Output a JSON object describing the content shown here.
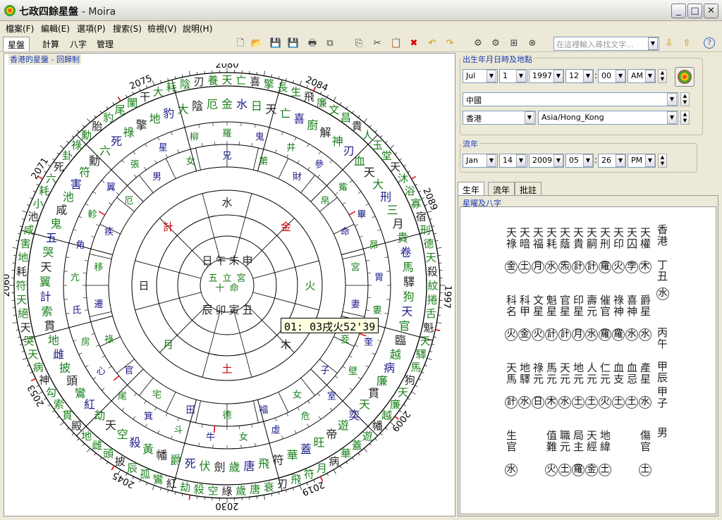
{
  "window": {
    "title": "七政四餘星盤",
    "app": "- Moira",
    "minimize": "_",
    "maximize": "□",
    "close": "✕"
  },
  "menu": [
    "檔案(F)",
    "編輯(E)",
    "選項(P)",
    "搜索(S)",
    "檢視(V)",
    "說明(H)"
  ],
  "toolbar": {
    "tabs": [
      "星盤",
      "計算",
      "八字",
      "管理"
    ],
    "search_placeholder": "在這裡輸入尋找文字...",
    "icons": [
      "new-icon",
      "open-icon",
      "save-icon",
      "save-as-icon",
      "print-icon",
      "export-icon",
      "copy-icon",
      "cut-icon",
      "paste-icon",
      "delete-icon",
      "undo-icon",
      "redo-icon",
      "tool1-icon",
      "tool2-icon",
      "tool3-icon",
      "tool4-icon"
    ]
  },
  "chart": {
    "caption": "香港的星盤 - 回歸制",
    "tooltip": "01: 03戌火52'39",
    "years": [
      {
        "t": "2080",
        "a": -90
      },
      {
        "t": "2084",
        "a": -66
      },
      {
        "t": "2089",
        "a": -23
      },
      {
        "t": "1997",
        "a": 3
      },
      {
        "t": "2009",
        "a": 38
      },
      {
        "t": "2019",
        "a": 67
      },
      {
        "t": "2030",
        "a": 90
      },
      {
        "t": "2045",
        "a": 118
      },
      {
        "t": "2053",
        "a": 150
      },
      {
        "t": "2060",
        "a": 180
      },
      {
        "t": "2071",
        "a": -148
      },
      {
        "t": "2075",
        "a": -113
      }
    ],
    "center": [
      "五",
      "十",
      "立",
      "命",
      "宮"
    ],
    "pillars": [
      [
        "日",
        "午",
        "未",
        "申"
      ],
      [
        "辰",
        "卯",
        "寅",
        "丑"
      ]
    ],
    "ring1": [
      "水",
      "金",
      "火",
      "木",
      "土",
      "月",
      "日",
      "計"
    ],
    "ring2": [
      "兄",
      "第",
      "財",
      "帛",
      "命",
      "宮",
      "妻",
      "妾",
      "子",
      "女",
      "福",
      "德",
      "田",
      "宅",
      "官",
      "祿",
      "遷",
      "移",
      "疾",
      "厄",
      "男",
      "女"
    ],
    "ring3": [
      "羅",
      "鬼",
      "井",
      "參",
      "觜",
      "畢",
      "昴",
      "胃",
      "婁",
      "奎",
      "壁",
      "室",
      "危",
      "虛",
      "女",
      "牛",
      "斗",
      "箕",
      "尾",
      "心",
      "房",
      "氐",
      "亢",
      "角",
      "軫",
      "翼",
      "張",
      "星",
      "柳"
    ],
    "ring4": [
      "金",
      "水",
      "日",
      "天",
      "亡",
      "喜",
      "廚",
      "解",
      "神",
      "刃",
      "血",
      "天",
      "大",
      "刑",
      "三",
      "月",
      "貴",
      "卷",
      "馬",
      "驛",
      "狗",
      "天",
      "官",
      "臨",
      "越",
      "病",
      "廉",
      "貫",
      "天",
      "奕",
      "遊",
      "帝",
      "旺",
      "蓋",
      "華",
      "符",
      "飛",
      "唐",
      "歲",
      "劍",
      "伏",
      "死",
      "爵",
      "幡",
      "黃",
      "殺",
      "空",
      "天",
      "劫",
      "紅",
      "鸞",
      "頭",
      "披",
      "雌",
      "地",
      "貫",
      "索",
      "計",
      "翼",
      "天",
      "哭",
      "五",
      "鬼",
      "咸",
      "池",
      "害",
      "符",
      "勳",
      "六",
      "死",
      "祿",
      "擎",
      "地",
      "豹",
      "大",
      "陰",
      "厄"
    ],
    "outer": [
      "天",
      "亡",
      "喜",
      "擎",
      "長",
      "生",
      "飛",
      "廉",
      "文",
      "昌",
      "貴",
      "人",
      "玉",
      "堂",
      "天",
      "沐",
      "浴",
      "寡",
      "宿",
      "刑",
      "德",
      "天",
      "殺",
      "紋",
      "捲",
      "舌",
      "魁",
      "天",
      "驛",
      "馬",
      "狗",
      "天",
      "廉",
      "越",
      "幡",
      "遊",
      "蓋",
      "華",
      "病",
      "月",
      "符",
      "飛",
      "刃",
      "衰",
      "唐",
      "歲",
      "綠",
      "空",
      "殺",
      "劫",
      "紅",
      "鸞",
      "孤",
      "辰",
      "披",
      "頭",
      "雌",
      "地",
      "殿",
      "貫",
      "索",
      "勾",
      "神",
      "病",
      "天",
      "哭",
      "天",
      "絕",
      "天",
      "符",
      "耗",
      "地",
      "害",
      "咸",
      "池",
      "小",
      "耗",
      "六",
      "死",
      "卦",
      "祿",
      "勳",
      "胎",
      "豹",
      "尾",
      "闌",
      "干",
      "大",
      "耗",
      "陰",
      "刃",
      "養"
    ]
  },
  "birth": {
    "group": "出生年月日時及地點",
    "month": "Jul",
    "day": "1",
    "year": "1997",
    "hour": "12",
    "minute": "00",
    "ampm": "AM",
    "country": "中國",
    "city": "香港",
    "timezone": "Asia/Hong_Kong"
  },
  "transit": {
    "group": "流年",
    "month": "Jan",
    "day": "14",
    "year": "2009",
    "hour": "05",
    "minute": "26",
    "ampm": "PM"
  },
  "tabs": {
    "natal": "生年",
    "annual": "流年",
    "notes": "批註"
  },
  "stars": {
    "caption": "星曜及八字",
    "place": "香港",
    "year_pillar": "丁丑",
    "nayin": "水",
    "gender": "男",
    "bazi": [
      "丙午",
      "甲辰",
      "甲子"
    ],
    "row1": [
      [
        "天權",
        "木"
      ],
      [
        "天囚",
        "孛"
      ],
      [
        "天印",
        "火"
      ],
      [
        "天刑",
        "羅"
      ],
      [
        "天嗣",
        "計"
      ],
      [
        "天貴",
        "計"
      ],
      [
        "天蔭",
        "炁"
      ],
      [
        "天耗",
        "水"
      ],
      [
        "天福",
        "月"
      ],
      [
        "天暗",
        "土"
      ],
      [
        "天祿",
        "金"
      ]
    ],
    "row2": [
      [
        "爵星",
        "水"
      ],
      [
        "喜神",
        "水"
      ],
      [
        "祿神",
        "羅"
      ],
      [
        "催官",
        "羅"
      ],
      [
        "壽元",
        "水"
      ],
      [
        "印星",
        "月"
      ],
      [
        "官星",
        "計"
      ],
      [
        "魁星",
        "計"
      ],
      [
        "文星",
        "火"
      ],
      [
        "科甲",
        "金"
      ],
      [
        "科名",
        "火"
      ]
    ],
    "row3": [
      [
        "產星",
        "水"
      ],
      [
        "血忌",
        "土"
      ],
      [
        "血支",
        "土"
      ],
      [
        "仁元",
        "火"
      ],
      [
        "人元",
        "土"
      ],
      [
        "地元",
        "土"
      ],
      [
        "天元",
        "水"
      ],
      [
        "馬元",
        "木"
      ],
      [
        "祿元",
        "日"
      ],
      [
        "地驛",
        "水"
      ],
      [
        "天馬",
        "計"
      ]
    ],
    "row4": [
      [
        "傷官",
        "土"
      ],
      [
        "",
        ""
      ],
      [
        "",
        ""
      ],
      [
        "地緯",
        "土"
      ],
      [
        "天經",
        "金"
      ],
      [
        "局主",
        "羅"
      ],
      [
        "職元",
        "土"
      ],
      [
        "值難",
        "火"
      ],
      [
        "",
        ""
      ],
      [
        "",
        ""
      ],
      [
        "生官",
        "水"
      ]
    ]
  }
}
